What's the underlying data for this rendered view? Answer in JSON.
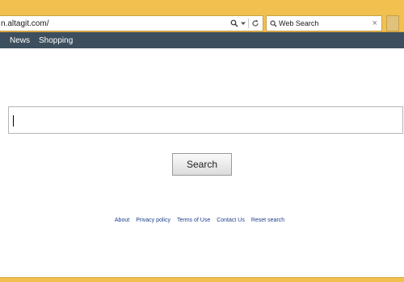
{
  "browser": {
    "address_url": "n.altagit.com/",
    "search_box_text": "Web Search",
    "search_close": "×",
    "icons": [
      "search-icon",
      "dropdown-arrow-icon",
      "refresh-icon",
      "magnifier-icon",
      "close-icon"
    ],
    "chrome_color": "#f2c04e"
  },
  "nav": {
    "items": [
      {
        "label": "News"
      },
      {
        "label": "Shopping"
      }
    ],
    "bar_color": "#3d4f5e"
  },
  "main": {
    "search_value": "",
    "search_button_label": "Search"
  },
  "footer": {
    "links": [
      {
        "label": "About"
      },
      {
        "label": "Privacy policy"
      },
      {
        "label": "Terms of Use"
      },
      {
        "label": "Contact Us"
      },
      {
        "label": "Reset search"
      }
    ],
    "link_color": "#1d3f8a"
  }
}
